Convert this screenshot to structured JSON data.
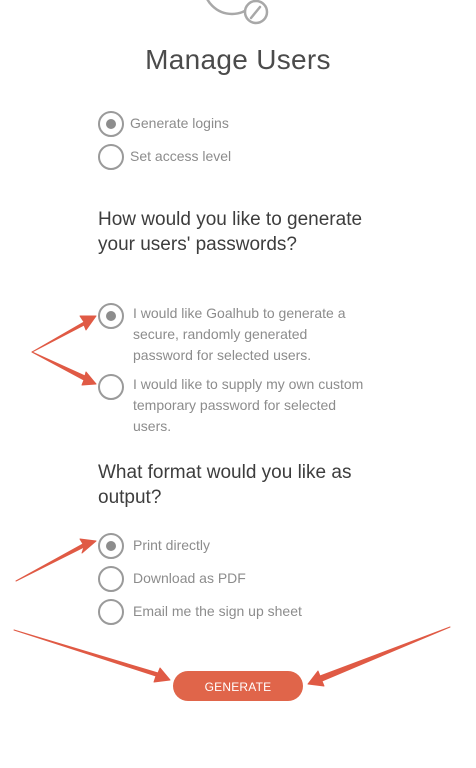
{
  "title": "Manage Users",
  "mode_options": [
    {
      "label": "Generate logins",
      "checked": true
    },
    {
      "label": "Set access level",
      "checked": false
    }
  ],
  "password_section": {
    "question": "How would you like to generate your users' passwords?",
    "options": [
      {
        "label": "I would like Goalhub to generate a secure, randomly generated password for selected users.",
        "checked": true
      },
      {
        "label": "I would like to supply my own custom temporary password for selected users.",
        "checked": false
      }
    ]
  },
  "format_section": {
    "question": "What format would you like as output?",
    "options": [
      {
        "label": "Print directly",
        "checked": true
      },
      {
        "label": "Download as PDF",
        "checked": false
      },
      {
        "label": "Email me the sign up sheet",
        "checked": false
      }
    ]
  },
  "generate_button": "GENERATE",
  "colors": {
    "accent": "#e0654a",
    "annotation_arrow": "#e05a45",
    "text_muted": "#8c8c8c",
    "text_dark": "#3d3d3d"
  },
  "icons": {
    "logo": "goal-gauge-icon"
  }
}
